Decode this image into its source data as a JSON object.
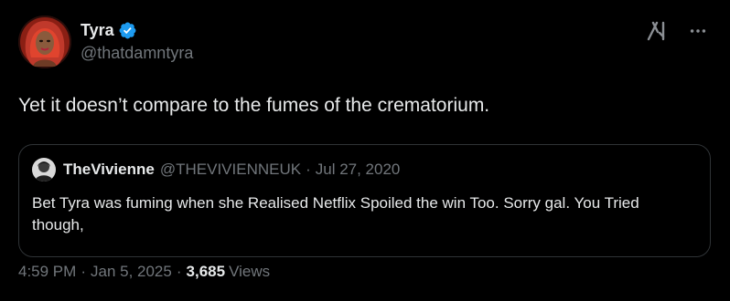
{
  "author": {
    "display_name": "Tyra",
    "handle": "@thatdamntyra",
    "verified": true,
    "avatar_icon": "avatar-red-hair-illustration"
  },
  "tweet": {
    "text": "Yet it doesn’t compare to the fumes of the crematorium."
  },
  "quote": {
    "display_name": "TheVivienne",
    "handle": "@THEVIVIENNEUK",
    "separator": "·",
    "date": "Jul 27, 2020",
    "text": "Bet Tyra was fuming when she Realised Netflix Spoiled the win Too. Sorry gal. You Tried though,"
  },
  "meta": {
    "time": "4:59 PM",
    "separator": "·",
    "date": "Jan 5, 2025",
    "views_count": "3,685",
    "views_label": "Views"
  },
  "colors": {
    "background": "#000000",
    "text_primary": "#e7e9ea",
    "text_secondary": "#71767b",
    "border": "#2f3336",
    "verified_blue": "#1d9bf0"
  },
  "icons": {
    "grok": "grok-icon",
    "more": "more-options-icon",
    "verified": "verified-badge-icon"
  }
}
